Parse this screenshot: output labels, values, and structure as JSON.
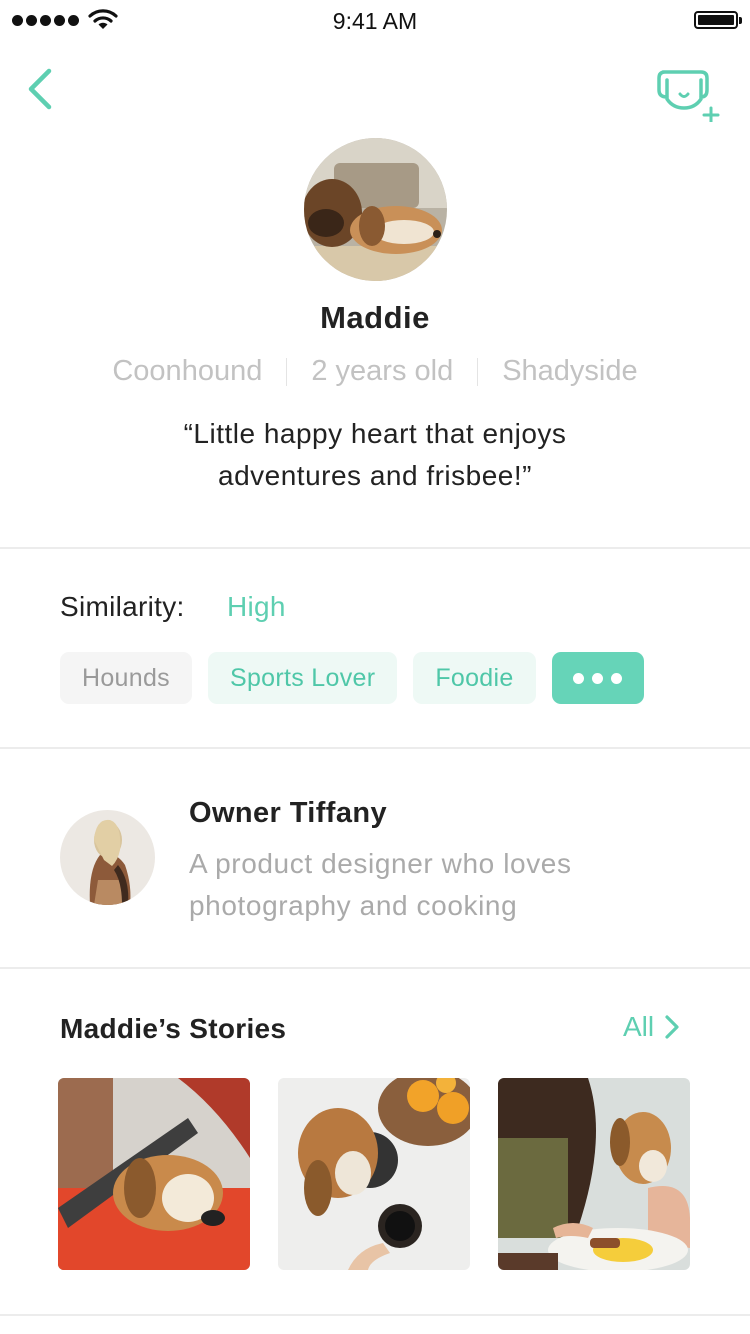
{
  "status_bar": {
    "time": "9:41 AM"
  },
  "nav": {
    "back_icon": "chevron-left-icon",
    "add_icon": "add-dog-icon"
  },
  "profile": {
    "name": "Maddie",
    "breed": "Coonhound",
    "age": "2 years old",
    "location": "Shadyside",
    "bio_line1": "“Little happy heart that enjoys",
    "bio_line2": "adventures and frisbee!”"
  },
  "similarity": {
    "label": "Similarity:",
    "value": "High",
    "tags": [
      "Hounds",
      "Sports Lover",
      "Foodie"
    ],
    "more_icon": "more-dots-icon"
  },
  "owner": {
    "name": "Owner Tiffany",
    "bio_line1": "A product designer who loves",
    "bio_line2": "photography and cooking"
  },
  "stories": {
    "title": "Maddie’s Stories",
    "all_label": "All"
  },
  "colors": {
    "accent": "#5ecfb1",
    "accent_bg": "#eef9f5",
    "muted_text": "#c2c2c2",
    "divider": "#ececec"
  }
}
